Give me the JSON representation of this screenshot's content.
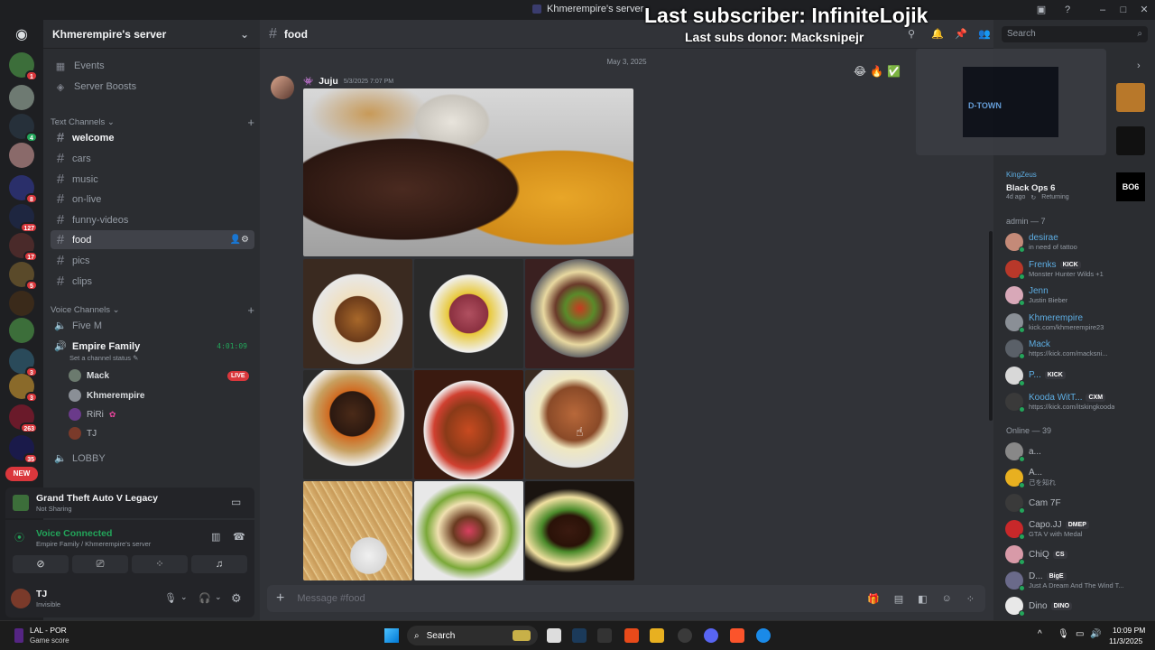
{
  "window": {
    "title": "Khmerempire's server",
    "controls": [
      "–",
      "□",
      "✕"
    ]
  },
  "overlay": {
    "line1": "Last subscriber: InfiniteLojik",
    "line2": "Last subs donor: Macksnipejr"
  },
  "rail": {
    "badges": [
      "1",
      "4",
      "8",
      "127",
      "17",
      "5",
      "3",
      "3",
      "263",
      "35"
    ],
    "new_label": "NEW"
  },
  "sidebar": {
    "server_name": "Khmerempire's server",
    "nav": [
      {
        "label": "Events",
        "icon": "calendar-icon"
      },
      {
        "label": "Server Boosts",
        "icon": "boost-icon"
      }
    ],
    "text_category": "Text Channels",
    "text_channels": [
      "welcome",
      "cars",
      "music",
      "on-live",
      "funny-videos",
      "food",
      "pics",
      "clips"
    ],
    "active_channel": "food",
    "voice_category": "Voice Channels",
    "voice_channels": {
      "five_m": "Five M",
      "empire": "Empire Family",
      "empire_timer": "4:01:09",
      "empire_status": "Set a channel status",
      "users": [
        {
          "name": "Mack",
          "live": "LIVE"
        },
        {
          "name": "Khmerempire"
        },
        {
          "name": "RiRi"
        },
        {
          "name": "TJ"
        }
      ],
      "lobby": "LOBBY"
    }
  },
  "game": {
    "title": "Grand Theft Auto V Legacy",
    "status": "Not Sharing"
  },
  "voice": {
    "status": "Voice Connected",
    "location": "Empire Family / Khmerempire's server"
  },
  "user": {
    "name": "TJ",
    "status": "Invisible"
  },
  "main": {
    "channel": "food",
    "date": "May 3, 2025",
    "message": {
      "author": "Juju",
      "timestamp": "5/3/2025 7:07 PM",
      "reactions": [
        "😂",
        "🔥",
        "✅"
      ]
    },
    "composer_placeholder": "Message #food"
  },
  "search": {
    "placeholder": "Search"
  },
  "activity": {
    "user": "KingZeus",
    "game": "Black Ops 6",
    "time": "4d ago",
    "state": "Returning",
    "thumb_label": "BO6",
    "preview_label": "D-TOWN"
  },
  "members": {
    "admin_header": "admin — 7",
    "admins": [
      {
        "name": "desirae",
        "sub": "in need of tattoo",
        "color": "#5dade2",
        "tag": ""
      },
      {
        "name": "Frenks",
        "sub": "Monster Hunter Wilds +1",
        "color": "#5dade2",
        "tag": "KICK"
      },
      {
        "name": "Jenn",
        "sub": "Justin Bieber",
        "color": "#5dade2",
        "tag": ""
      },
      {
        "name": "Khmerempire",
        "sub": "kick.com/khmerempire23",
        "color": "#5dade2",
        "tag": ""
      },
      {
        "name": "Mack",
        "sub": "https://kick.com/macksni...",
        "color": "#5dade2",
        "tag": ""
      },
      {
        "name": "P...",
        "sub": "",
        "color": "#5dade2",
        "tag": "KICK"
      },
      {
        "name": "Kooda WitT...",
        "sub": "https://kick.com/itskingkooda",
        "color": "#5dade2",
        "tag": "CXM"
      }
    ],
    "online_header": "Online — 39",
    "online": [
      {
        "name": "a...",
        "sub": "",
        "tag": ""
      },
      {
        "name": "A...",
        "sub": "己を知れ",
        "tag": ""
      },
      {
        "name": "Cam 7F",
        "sub": "",
        "tag": ""
      },
      {
        "name": "Capo.JJ",
        "sub": "GTA V with Medal",
        "tag": "DMEP"
      },
      {
        "name": "ChiQ",
        "sub": "",
        "tag": "CS"
      },
      {
        "name": "D...",
        "sub": "Just A Dream And The Wind T...",
        "tag": "BigE"
      },
      {
        "name": "Dino",
        "sub": "",
        "tag": "DINO"
      }
    ]
  },
  "taskbar": {
    "scoreboard": {
      "title": "LAL - POR",
      "sub": "Game score"
    },
    "search": "Search",
    "time": "10:09 PM",
    "date": "11/3/2025"
  }
}
